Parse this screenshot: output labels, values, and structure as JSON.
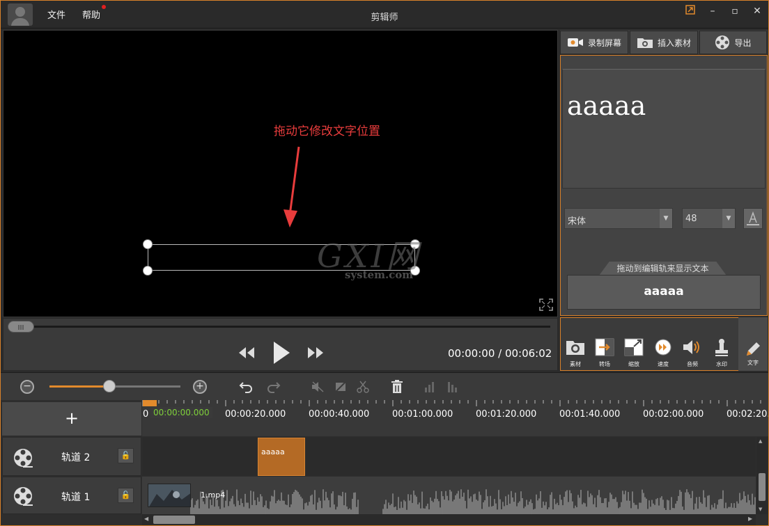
{
  "titlebar": {
    "menu": [
      "文件",
      "帮助"
    ],
    "title": "剪辑师"
  },
  "preview": {
    "annotation": "拖动它修改文字位置",
    "watermark_big": "GXI网",
    "watermark_small": "system.com"
  },
  "playback": {
    "time": "00:00:00 / 00:06:02"
  },
  "right_panel": {
    "buttons": [
      "录制屏幕",
      "插入素材",
      "导出"
    ],
    "text_preview": "aaaaa",
    "font": "宋体",
    "font_size": "48",
    "drag_hint": "拖动到编辑轨来显示文本",
    "drag_text": "aaaaa",
    "tools": [
      "素材",
      "转场",
      "缩放",
      "速度",
      "音频",
      "水印",
      "文字"
    ],
    "accent": "#d9812a"
  },
  "edit_toolbar": {
    "zoom_level": 0.46
  },
  "timeline": {
    "add_label": "+",
    "current_time": "00:00:00.000",
    "ruler": [
      "00:00:20.000",
      "00:00:40.000",
      "00:01:00.000",
      "00:01:20.000",
      "00:01:40.000",
      "00:02:00.000",
      "00:02:20."
    ],
    "tracks": [
      {
        "name": "轨道 2",
        "clip": "aaaaa"
      },
      {
        "name": "轨道 1",
        "clip": "1.mp4"
      }
    ]
  }
}
